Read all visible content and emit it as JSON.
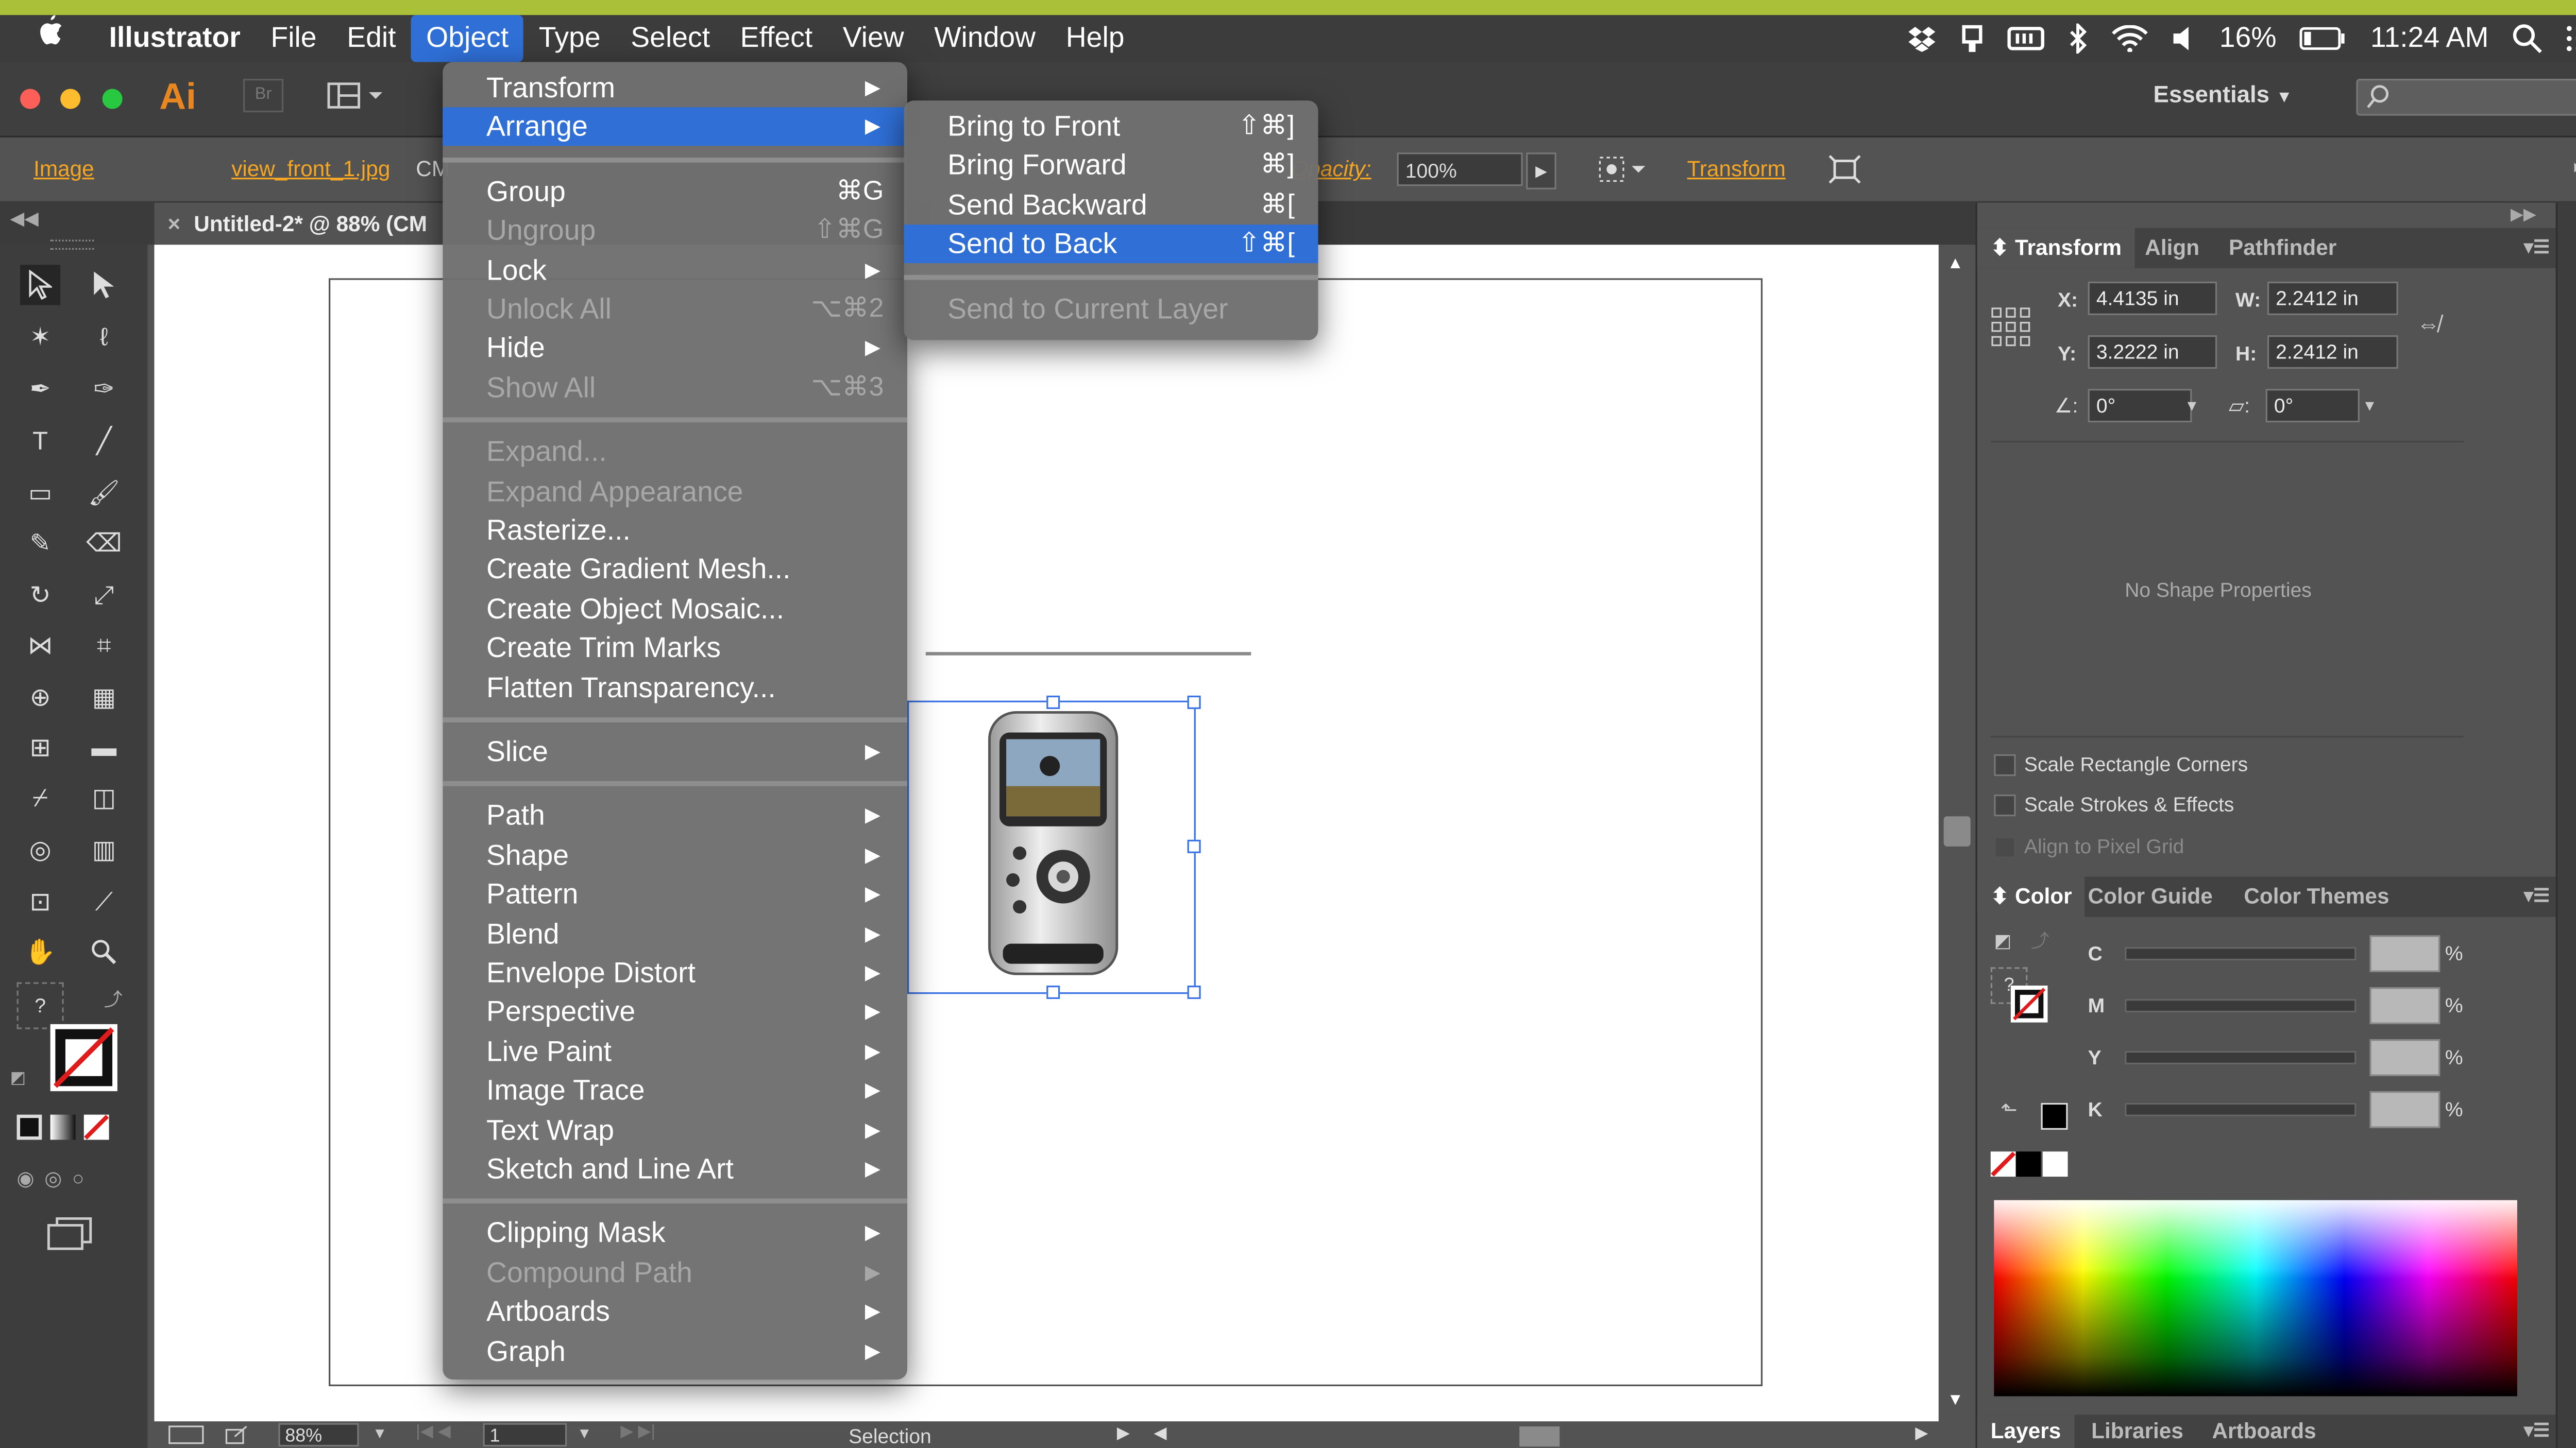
{
  "menubar": {
    "app_name": "Illustrator",
    "items": [
      "File",
      "Edit",
      "Object",
      "Type",
      "Select",
      "Effect",
      "View",
      "Window",
      "Help"
    ],
    "active_item": "Object",
    "status": {
      "battery": "16%",
      "time": "11:24 AM"
    }
  },
  "apptoolbar": {
    "app_logo": "Ai",
    "bridge_label": "Br",
    "workspace": "Essentials"
  },
  "controlbar": {
    "object_type": "Image",
    "filename": "view_front_1.jpg",
    "color_mode_fragment": "CM",
    "opacity_label": "Opacity:",
    "opacity_value": "100%",
    "transform_link": "Transform"
  },
  "document": {
    "tab_title": "Untitled-2* @ 88% (CM",
    "close_glyph": "×"
  },
  "object_menu": {
    "items": [
      {
        "label": "Transform",
        "submenu": true
      },
      {
        "label": "Arrange",
        "submenu": true,
        "highlight": true
      },
      {
        "sep": true
      },
      {
        "label": "Group",
        "shortcut": "⌘G"
      },
      {
        "label": "Ungroup",
        "shortcut": "⇧⌘G",
        "disabled": true
      },
      {
        "label": "Lock",
        "submenu": true
      },
      {
        "label": "Unlock All",
        "shortcut": "⌥⌘2",
        "disabled": true
      },
      {
        "label": "Hide",
        "submenu": true
      },
      {
        "label": "Show All",
        "shortcut": "⌥⌘3",
        "disabled": true
      },
      {
        "sep": true
      },
      {
        "label": "Expand...",
        "disabled": true
      },
      {
        "label": "Expand Appearance",
        "disabled": true
      },
      {
        "label": "Rasterize..."
      },
      {
        "label": "Create Gradient Mesh..."
      },
      {
        "label": "Create Object Mosaic..."
      },
      {
        "label": "Create Trim Marks"
      },
      {
        "label": "Flatten Transparency..."
      },
      {
        "sep": true
      },
      {
        "label": "Slice",
        "submenu": true
      },
      {
        "sep": true
      },
      {
        "label": "Path",
        "submenu": true
      },
      {
        "label": "Shape",
        "submenu": true
      },
      {
        "label": "Pattern",
        "submenu": true
      },
      {
        "label": "Blend",
        "submenu": true
      },
      {
        "label": "Envelope Distort",
        "submenu": true
      },
      {
        "label": "Perspective",
        "submenu": true
      },
      {
        "label": "Live Paint",
        "submenu": true
      },
      {
        "label": "Image Trace",
        "submenu": true
      },
      {
        "label": "Text Wrap",
        "submenu": true
      },
      {
        "label": "Sketch and Line Art",
        "submenu": true
      },
      {
        "sep": true
      },
      {
        "label": "Clipping Mask",
        "submenu": true
      },
      {
        "label": "Compound Path",
        "submenu": true,
        "disabled": true
      },
      {
        "label": "Artboards",
        "submenu": true
      },
      {
        "label": "Graph",
        "submenu": true
      }
    ]
  },
  "arrange_menu": {
    "items": [
      {
        "label": "Bring to Front",
        "shortcut": "⇧⌘]"
      },
      {
        "label": "Bring Forward",
        "shortcut": "⌘]"
      },
      {
        "label": "Send Backward",
        "shortcut": "⌘["
      },
      {
        "label": "Send to Back",
        "shortcut": "⇧⌘[",
        "highlight": true
      },
      {
        "sep": true
      },
      {
        "label": "Send to Current Layer",
        "disabled": true
      }
    ]
  },
  "transform_panel": {
    "tabs": [
      "Transform",
      "Align",
      "Pathfinder"
    ],
    "x_label": "X:",
    "x": "4.4135 in",
    "y_label": "Y:",
    "y": "3.2222 in",
    "w_label": "W:",
    "w": "2.2412 in",
    "h_label": "H:",
    "h": "2.2412 in",
    "angle": "0°",
    "shear": "0°",
    "no_shape": "No Shape Properties",
    "checkboxes": [
      "Scale Rectangle Corners",
      "Scale Strokes & Effects",
      "Align to Pixel Grid"
    ]
  },
  "color_panel": {
    "tabs": [
      "Color",
      "Color Guide",
      "Color Themes"
    ],
    "channels": [
      "C",
      "M",
      "Y",
      "K"
    ],
    "percent": "%"
  },
  "bottom_panel": {
    "tabs": [
      "Layers",
      "Libraries",
      "Artboards"
    ]
  },
  "statusbar": {
    "zoom": "88%",
    "page": "1",
    "tool_name": "Selection"
  },
  "colors": {
    "accent_highlight": "#2f6fd6",
    "menu_bg": "#707070",
    "control_link": "#f5a623",
    "top_strip": "#a9c038"
  }
}
